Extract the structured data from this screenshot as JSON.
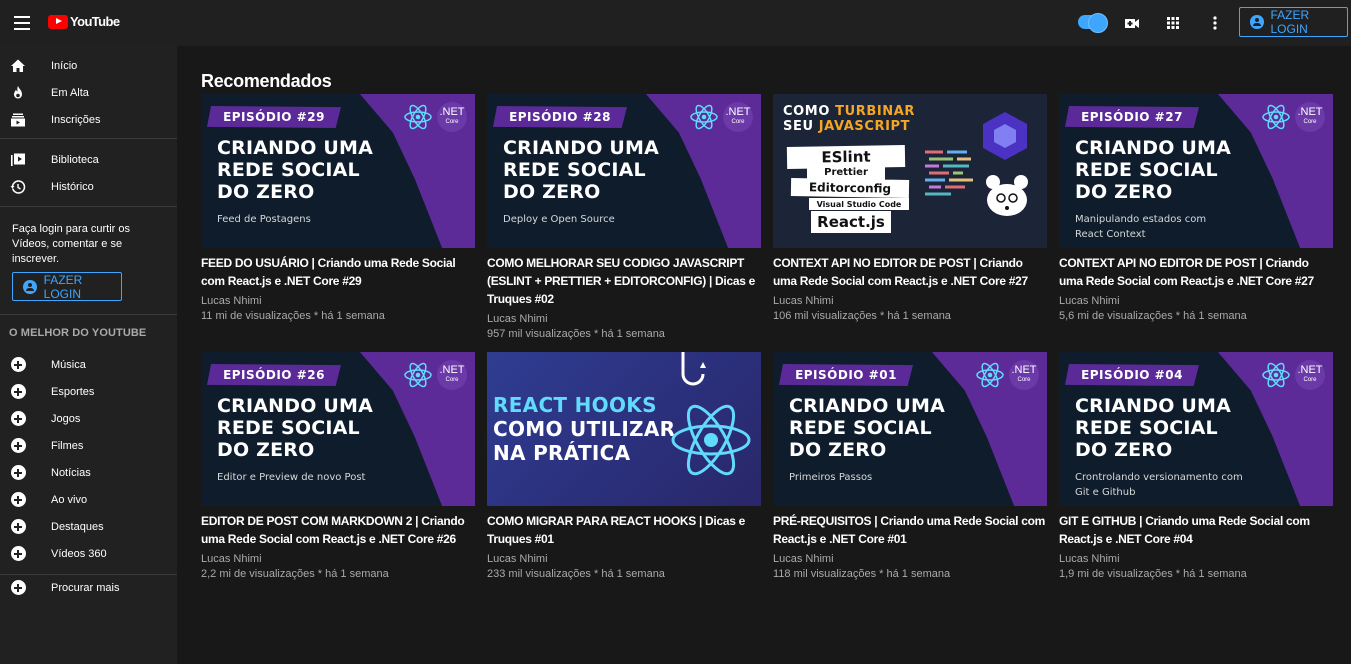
{
  "header": {
    "logo_text": "YouTube",
    "login_label": "FAZER LOGIN",
    "accent": "#3ea6ff",
    "icons": [
      "menu-icon",
      "youtube-logo-icon",
      "toggle-switch",
      "video-camera-icon",
      "apps-grid-icon",
      "more-vert-icon",
      "account-circle-icon"
    ]
  },
  "sidebar": {
    "primary": [
      {
        "label": "Início",
        "icon": "home-icon"
      },
      {
        "label": "Em Alta",
        "icon": "fire-icon"
      },
      {
        "label": "Inscrições",
        "icon": "subscriptions-icon"
      }
    ],
    "library": [
      {
        "label": "Biblioteca",
        "icon": "library-icon"
      },
      {
        "label": "Histórico",
        "icon": "history-icon"
      }
    ],
    "login_note": "Faça login para curtir os Vídeos, comentar e se inscrever.",
    "login_label": "FAZER LOGIN",
    "best_heading": "O MELHOR DO YOUTUBE",
    "best": [
      {
        "label": "Música"
      },
      {
        "label": "Esportes"
      },
      {
        "label": "Jogos"
      },
      {
        "label": "Filmes"
      },
      {
        "label": "Notícias"
      },
      {
        "label": "Ao vivo"
      },
      {
        "label": "Destaques"
      },
      {
        "label": "Vídeos 360"
      }
    ],
    "more": {
      "label": "Procurar mais"
    }
  },
  "main": {
    "section_title": "Recomendados",
    "videos": [
      {
        "title": "FEED DO USUÁRIO | Criando uma Rede Social com React.js e .NET Core #29",
        "channel": "Lucas Nhimi",
        "meta": "11 mi de visualizações * há 1 semana",
        "thumb": {
          "episode": "EPISÓDIO #29",
          "line1": "CRIANDO UMA",
          "line2": "REDE SOCIAL",
          "line3": "DO ZERO",
          "sub": "Feed de Postagens",
          "net": ".NET",
          "net_sub": "Core"
        }
      },
      {
        "title": "COMO MELHORAR SEU CODIGO JAVASCRIPT (ESLINT + PRETTIER + EDITORCONFIG) | Dicas e Truques #02",
        "channel": "Lucas Nhimi",
        "meta": "957 mil visualizações * há 1 semana",
        "thumb": {
          "episode": "EPISÓDIO #28",
          "line1": "CRIANDO UMA",
          "line2": "REDE SOCIAL",
          "line3": "DO ZERO",
          "sub": "Deploy e Open Source",
          "net": ".NET",
          "net_sub": "Core"
        }
      },
      {
        "title": "CONTEXT API NO EDITOR DE POST | Criando uma Rede Social com React.js e .NET Core #27",
        "channel": "Lucas Nhimi",
        "meta": "106 mil visualizações * há 1 semana",
        "thumb": {
          "top1a": "COMO ",
          "top1b": "TURBINAR",
          "top2a": "SEU ",
          "top2b": "JAVASCRIPT",
          "t1": "ESlint",
          "t2": "Prettier",
          "t3": "Editorconfig",
          "t4": "Visual Studio Code",
          "t5": "React.js"
        }
      },
      {
        "title": "CONTEXT API NO EDITOR DE POST | Criando uma Rede Social com React.js e .NET Core #27",
        "channel": "Lucas Nhimi",
        "meta": "5,6 mi de visualizações * há 1 semana",
        "thumb": {
          "episode": "EPISÓDIO #27",
          "line1": "CRIANDO UMA",
          "line2": "REDE SOCIAL",
          "line3": "DO ZERO",
          "sub": "Manipulando estados com React Context",
          "net": ".NET",
          "net_sub": "Core"
        }
      },
      {
        "title": "EDITOR DE POST COM MARKDOWN 2 | Criando uma Rede Social com React.js e .NET Core #26",
        "channel": "Lucas Nhimi",
        "meta": "2,2 mi de visualizações * há 1 semana",
        "thumb": {
          "episode": "EPISÓDIO #26",
          "line1": "CRIANDO UMA",
          "line2": "REDE SOCIAL",
          "line3": "DO ZERO",
          "sub": "Editor e Preview de novo Post",
          "net": ".NET",
          "net_sub": "Core"
        }
      },
      {
        "title": "COMO MIGRAR PARA REACT HOOKS | Dicas e Truques #01",
        "channel": "Lucas Nhimi",
        "meta": "233 mil visualizações * há 1 semana",
        "thumb": {
          "h1": "REACT HOOKS",
          "h2": "COMO UTILIZAR",
          "h3": "NA PRÁTICA"
        }
      },
      {
        "title": "PRÉ-REQUISITOS | Criando uma Rede Social com React.js e .NET Core #01",
        "channel": "Lucas Nhimi",
        "meta": "118 mil visualizações * há 1 semana",
        "thumb": {
          "episode": "EPISÓDIO #01",
          "line1": "CRIANDO UMA",
          "line2": "REDE SOCIAL",
          "line3": "DO ZERO",
          "sub": "Primeiros Passos",
          "net": ".NET",
          "net_sub": "Core"
        }
      },
      {
        "title": "GIT E GITHUB | Criando uma Rede Social com React.js e .NET Core #04",
        "channel": "Lucas Nhimi",
        "meta": "1,9 mi de visualizações * há 1 semana",
        "thumb": {
          "episode": "EPISÓDIO #04",
          "line1": "CRIANDO UMA",
          "line2": "REDE SOCIAL",
          "line3": "DO ZERO",
          "sub": "Crontrolando versionamento com Git e Github",
          "net": ".NET",
          "net_sub": "Core"
        }
      }
    ]
  }
}
